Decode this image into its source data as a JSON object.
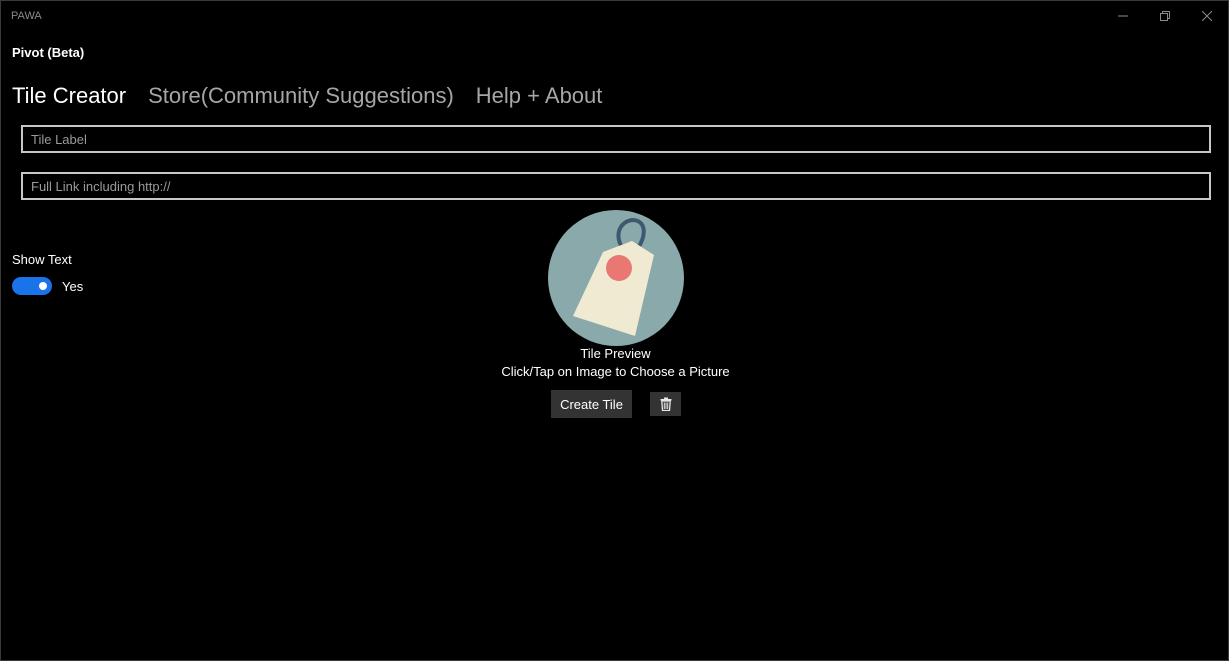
{
  "window": {
    "app_title": "PAWA",
    "controls": {
      "minimize_icon": "minimize-icon",
      "restore_icon": "restore-icon",
      "close_icon": "close-icon"
    }
  },
  "pivot": {
    "title": "Pivot (Beta)",
    "tabs": [
      {
        "label": "Tile Creator",
        "active": true
      },
      {
        "label": "Store(Community Suggestions)",
        "active": false
      },
      {
        "label": "Help + About",
        "active": false
      }
    ]
  },
  "form": {
    "tile_label": {
      "value": "",
      "placeholder": "Tile Label"
    },
    "full_link": {
      "value": "",
      "placeholder": "Full Link including http://"
    }
  },
  "show_text": {
    "label": "Show Text",
    "state_label": "Yes",
    "on": true
  },
  "preview": {
    "image_icon": "price-tag-icon",
    "title": "Tile Preview",
    "hint": "Click/Tap on Image to Choose a Picture"
  },
  "actions": {
    "create_label": "Create Tile",
    "delete_icon": "trash-icon"
  },
  "colors": {
    "background": "#000000",
    "toggle_on": "#1a73e8",
    "button_bg": "#333333",
    "preview_circle": "#8aa9aa",
    "tag_body": "#f1ead3",
    "tag_dot": "#e97872",
    "tag_string": "#3e5870"
  }
}
